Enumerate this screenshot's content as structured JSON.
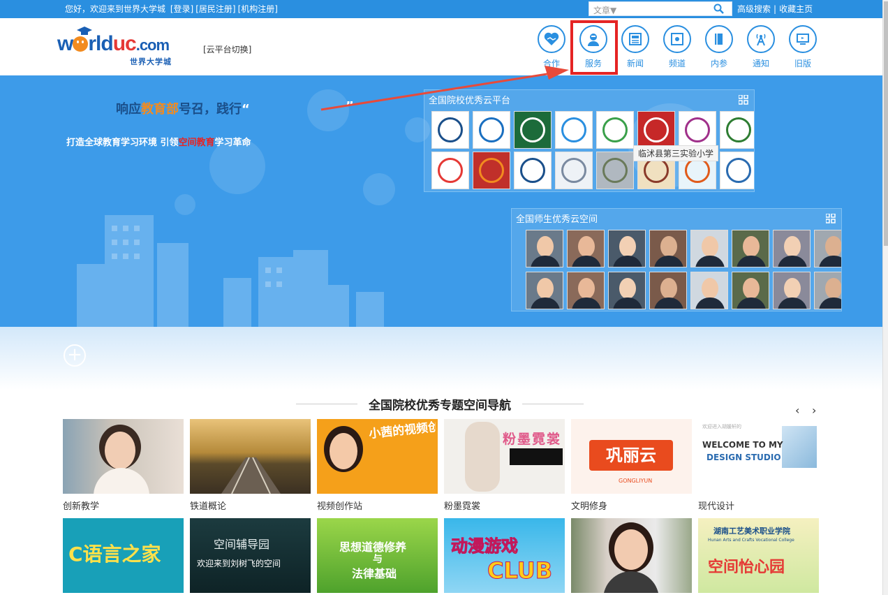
{
  "topbar": {
    "greeting": "您好，欢迎来到世界大学城",
    "login": "[登录]",
    "resident_register": "[居民注册]",
    "org_register": "[机构注册]",
    "search_type": "文章▼",
    "advanced_search": "高级搜索",
    "bookmark": "收藏主页"
  },
  "header": {
    "logo_text": "worlduc.com",
    "logo_sub": "世界大学城",
    "cloud_switch": "[云平台切换]",
    "nav": [
      {
        "label": "合作",
        "icon": "handshake-heart-icon"
      },
      {
        "label": "服务",
        "icon": "service-person-icon"
      },
      {
        "label": "新闻",
        "icon": "newspaper-icon"
      },
      {
        "label": "频道",
        "icon": "channel-icon"
      },
      {
        "label": "内参",
        "icon": "book-icon"
      },
      {
        "label": "通知",
        "icon": "broadcast-icon"
      },
      {
        "label": "旧版",
        "icon": "monitor-icon"
      }
    ]
  },
  "banner": {
    "slogan_pre": "响应",
    "slogan_hl": "教育部",
    "slogan_post": "号召，践行",
    "slogan_quote": "“",
    "slogan_quote2": "”",
    "sub_pre": "打造全球教育学习环境  引领",
    "sub_red": "空间教育",
    "sub_post": "学习革命",
    "school_panel_title": "全国院校优秀云平台",
    "teacher_panel_title": "全国师生优秀云空间",
    "tooltip": "临沭县第三实验小学"
  },
  "section": {
    "title": "全国院校优秀专题空间导航",
    "prev": "‹",
    "next": "›",
    "cards": [
      {
        "caption": "创新教学"
      },
      {
        "caption": "铁道概论"
      },
      {
        "caption": "视频创作站",
        "art": "小茜的视频创作站"
      },
      {
        "caption": "粉墨霓裳",
        "art": "粉墨霓裳"
      },
      {
        "caption": "文明修身",
        "art": "巩丽云",
        "art_sub": "GONGLIYUN"
      },
      {
        "caption": "现代设计",
        "art": "WELCOME TO MY",
        "art2": "DESIGN STUDIO",
        "art3": "欢迎进入胡媛轩的"
      },
      {
        "art": "C语言之家"
      },
      {
        "art": "空间辅导园",
        "art2": "欢迎来到刘树飞的空间"
      },
      {
        "art": "思想道德修养",
        "art2": "与",
        "art3": "法律基础"
      },
      {
        "art": "动漫游戏",
        "art2": "CLUB"
      },
      {},
      {
        "art": "湖南工艺美术职业学院",
        "art2": "Hunan Arts and Crafts Vocational College",
        "art3": "空间怡心园"
      }
    ]
  },
  "colors": {
    "topbar": "#2a8fe0",
    "banner": "#3d9be9",
    "accent_red": "#e52424",
    "orange": "#f28b1f"
  }
}
